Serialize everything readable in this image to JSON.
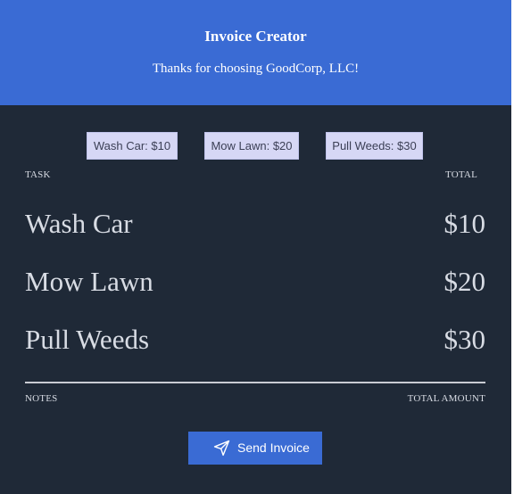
{
  "header": {
    "title": "Invoice Creator",
    "subtitle": "Thanks for choosing GoodCorp, LLC!"
  },
  "task_buttons": [
    {
      "label": "Wash Car: $10"
    },
    {
      "label": "Mow Lawn: $20"
    },
    {
      "label": "Pull Weeds: $30"
    }
  ],
  "table": {
    "task_header": "TASK",
    "total_header": "TOTAL",
    "rows": [
      {
        "task": "Wash Car",
        "total": "$10"
      },
      {
        "task": "Mow Lawn",
        "total": "$20"
      },
      {
        "task": "Pull Weeds",
        "total": "$30"
      }
    ]
  },
  "footer": {
    "notes_label": "NOTES",
    "total_amount_label": "TOTAL AMOUNT"
  },
  "send_button": {
    "label": "Send Invoice",
    "icon": "paper-plane-icon"
  },
  "colors": {
    "accent": "#3a6bd4",
    "background": "#1f2937",
    "task_button_bg": "#d6d7f5"
  }
}
